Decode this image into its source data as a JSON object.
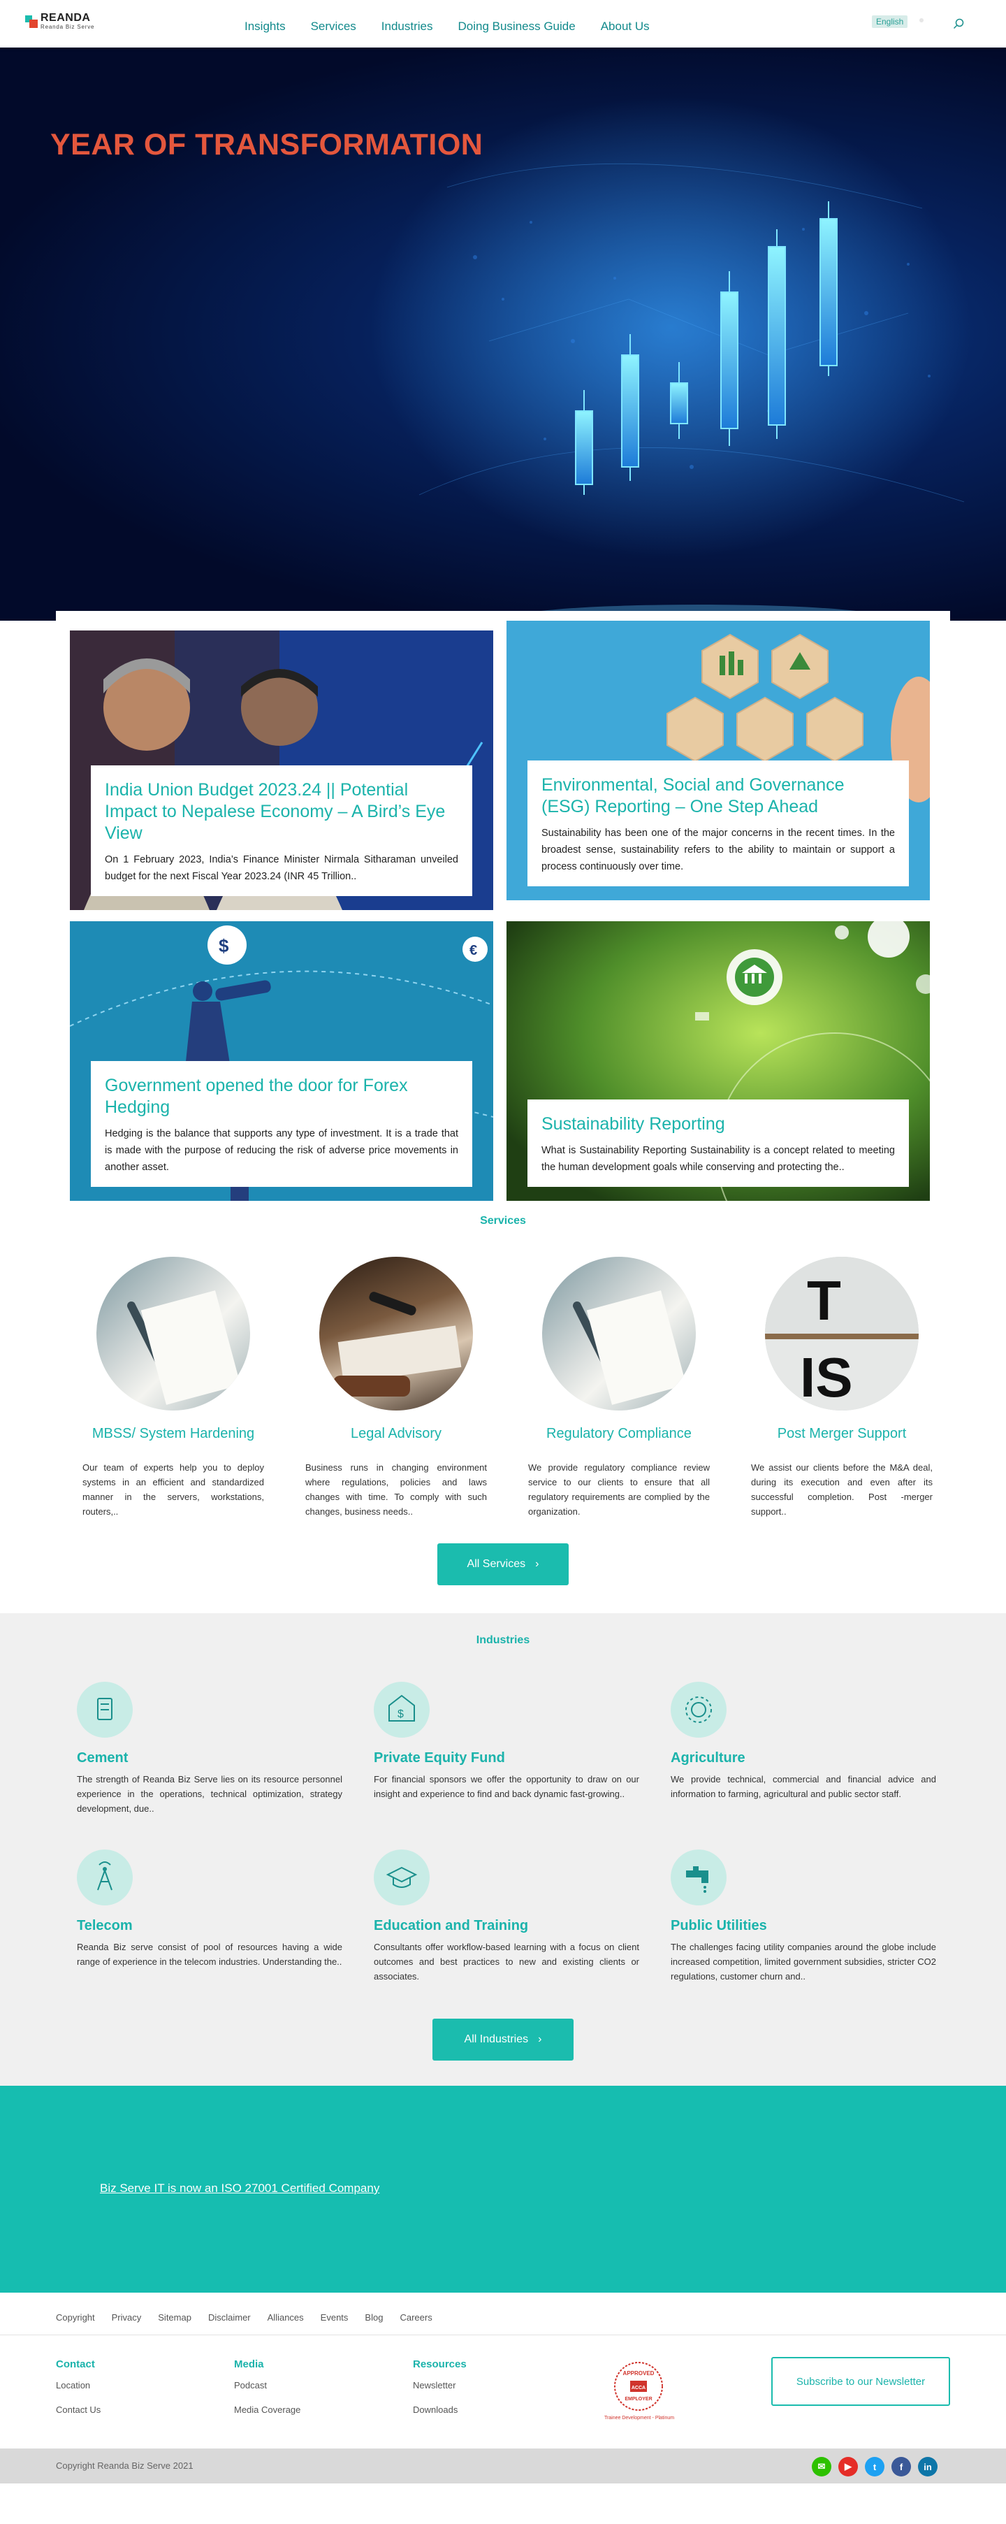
{
  "header": {
    "logo_name": "REANDA",
    "logo_sub": "Reanda Biz Serve",
    "nav": [
      "Insights",
      "Services",
      "Industries",
      "Doing Business Guide",
      "About Us"
    ],
    "language": "English"
  },
  "hero": {
    "title": "YEAR OF TRANSFORMATION"
  },
  "articles": [
    {
      "title": "India Union Budget 2023.24 || Potential Impact to Nepalese Economy – A Bird’s Eye View",
      "excerpt": "On 1 February 2023, India’s Finance Minister Nirmala Sitharaman unveiled budget for the next Fiscal Year 2023.24 (INR 45 Trillion.."
    },
    {
      "title": "Environmental, Social and Governance (ESG) Reporting – One Step Ahead",
      "excerpt": "Sustainability has been one of the major concerns in the recent times. In the broadest sense, sustainability refers to the ability to maintain or support a process continuously over time."
    },
    {
      "title": "Government opened the door for Forex Hedging",
      "excerpt": "Hedging is the balance that supports any type of investment. It is a trade that is made with the purpose of reducing the risk of adverse price movements in another asset."
    },
    {
      "title": "Sustainability Reporting",
      "excerpt": "What is Sustainability Reporting Sustainability is a concept related to meeting the human development goals while conserving and protecting the.."
    }
  ],
  "services": {
    "heading": "Services",
    "items": [
      {
        "title": "MBSS/ System Hardening",
        "text": "Our team of experts help you to deploy systems in an efficient and standardized manner in the servers, workstations, routers,.."
      },
      {
        "title": "Legal Advisory",
        "text": "Business runs in changing environment where regulations, policies and laws changes with time. To comply with such changes, business needs.."
      },
      {
        "title": "Regulatory Compliance",
        "text": "We provide regulatory compliance review service to our clients to ensure that all regulatory requirements are complied by the organization."
      },
      {
        "title": "Post Merger Support",
        "text": "We assist our clients before the M&A deal, during its execution and even after its successful completion. Post -merger support.."
      }
    ],
    "button": "All Services",
    "tile_letters": [
      "T",
      "IS"
    ]
  },
  "industries": {
    "heading": "Industries",
    "items": [
      {
        "title": "Cement",
        "icon": "cement-icon",
        "text": "The strength of Reanda Biz Serve lies on its resource personnel experience in the operations, technical optimization, strategy development, due.."
      },
      {
        "title": "Private Equity Fund",
        "icon": "fund-icon",
        "text": "For financial sponsors we offer the opportunity to draw on our insight and experience to find and back dynamic fast-growing.."
      },
      {
        "title": "Agriculture",
        "icon": "agriculture-icon",
        "text": "We provide technical, commercial and financial advice and information to farming, agricultural and public sector staff."
      },
      {
        "title": "Telecom",
        "icon": "tower-icon",
        "text": "Reanda Biz serve consist of pool of resources having a wide range of experience in the telecom industries. Understanding the.."
      },
      {
        "title": "Education and Training",
        "icon": "graduation-icon",
        "text": "Consultants offer workflow-based learning with a focus on client outcomes and best practices to new and existing clients or associates."
      },
      {
        "title": "Public Utilities",
        "icon": "faucet-icon",
        "text": "The challenges facing utility companies around the globe include increased competition, limited government subsidies, stricter CO2 regulations, customer churn and.."
      }
    ],
    "button": "All Industries"
  },
  "iso": {
    "link": "Biz Serve IT is now an ISO 27001 Certified Company"
  },
  "footer": {
    "links": [
      "Copyright",
      "Privacy",
      "Sitemap",
      "Disclaimer",
      "Alliances",
      "Events",
      "Blog",
      "Careers"
    ],
    "columns": [
      {
        "title": "Contact",
        "items": [
          "Location",
          "Contact Us"
        ]
      },
      {
        "title": "Media",
        "items": [
          "Podcast",
          "Media Coverage"
        ]
      },
      {
        "title": "Resources",
        "items": [
          "Newsletter",
          "Downloads"
        ]
      }
    ],
    "badge": {
      "top": "APPROVED",
      "bottom": "EMPLOYER",
      "center": "ACCA",
      "caption": "Trainee Development - Platinum"
    },
    "newsletter": "Subscribe to our Newsletter",
    "copyright": "Copyright Reanda Biz Serve 2021",
    "social": [
      {
        "name": "wechat-icon",
        "glyph": "✉",
        "color": "#2dc100"
      },
      {
        "name": "youtube-icon",
        "glyph": "▶",
        "color": "#e52d27"
      },
      {
        "name": "twitter-icon",
        "glyph": "t",
        "color": "#1da1f2"
      },
      {
        "name": "facebook-icon",
        "glyph": "f",
        "color": "#3b5998"
      },
      {
        "name": "linkedin-icon",
        "glyph": "in",
        "color": "#0e76a8"
      }
    ]
  }
}
